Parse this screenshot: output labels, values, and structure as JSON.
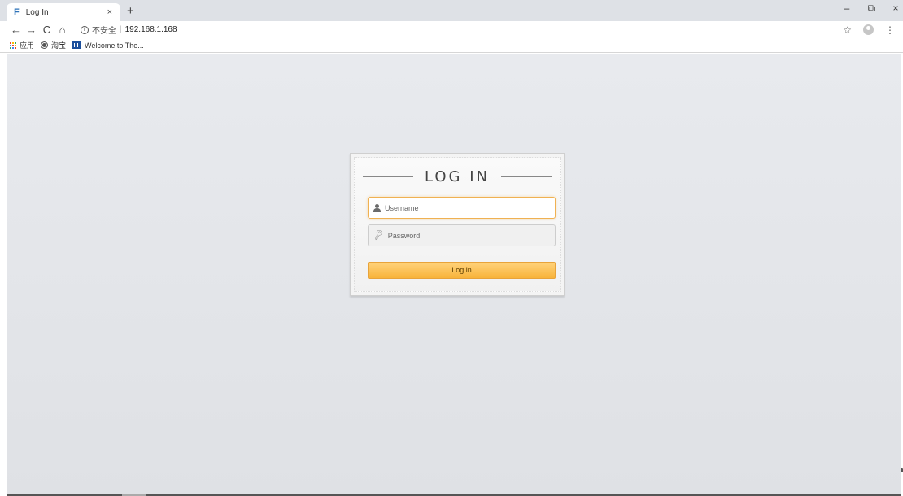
{
  "browser": {
    "tab": {
      "favicon": "F",
      "title": "Log In",
      "close": "×"
    },
    "new_tab": "+",
    "window_controls": {
      "minimize": "–",
      "restore": "⧉",
      "close": "×"
    },
    "nav": {
      "back": "←",
      "forward": "→",
      "reload": "C",
      "home": "⌂"
    },
    "address": {
      "info": "i",
      "security_label": "不安全",
      "separator": "|",
      "url": "192.168.1.168"
    },
    "star": "☆",
    "menu": "⋮",
    "bookmarks": [
      {
        "label": "应用",
        "icon": "apps-grid-icon"
      },
      {
        "label": "淘宝",
        "icon": "globe-icon"
      },
      {
        "label": "Welcome to The...",
        "icon": "site-icon"
      }
    ]
  },
  "login": {
    "title": "LOG IN",
    "username_placeholder": "Username",
    "password_placeholder": "Password",
    "button_label": "Log in"
  },
  "colors": {
    "button_top": "#ffd27a",
    "button_bottom": "#f8b33a",
    "focus_border": "#f0b152",
    "page_bg": "#e5e7eb"
  }
}
